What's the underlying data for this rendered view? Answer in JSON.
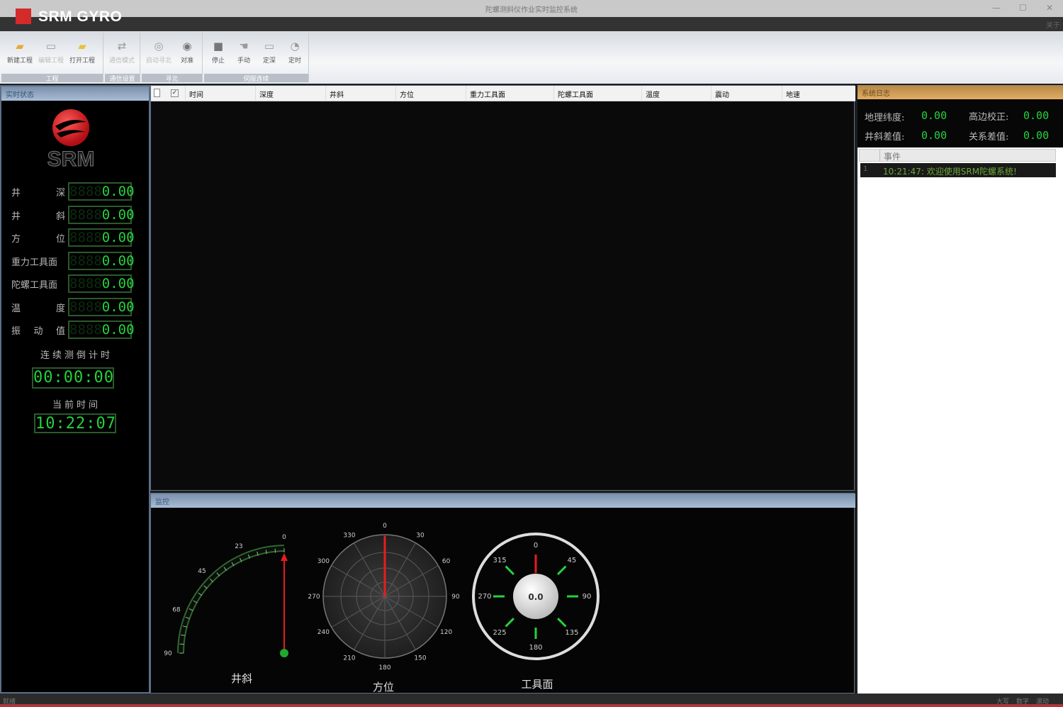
{
  "app": {
    "window_title": "陀螺测斜仪作业实时监控系统",
    "brand": "SRM GYRO",
    "menu_right": "关于"
  },
  "ribbon": {
    "groups": [
      {
        "label": "工程",
        "buttons": [
          "新建工程",
          "编辑工程",
          "打开工程"
        ]
      },
      {
        "label": "通信设置",
        "buttons": [
          "通信模式"
        ]
      },
      {
        "label": "寻北",
        "buttons": [
          "启动寻北",
          "对准"
        ]
      },
      {
        "label": "伺服连续",
        "buttons": [
          "停止",
          "手动",
          "定深",
          "定时"
        ]
      }
    ]
  },
  "realtime": {
    "header": "实时状态",
    "logo_text": "SRM",
    "rows": [
      {
        "label": [
          "井",
          "深"
        ],
        "value": "0.00",
        "ghost": "8888"
      },
      {
        "label": [
          "井",
          "斜"
        ],
        "value": "0.00",
        "ghost": "8888"
      },
      {
        "label": [
          "方",
          "位"
        ],
        "value": "0.00",
        "ghost": "8888"
      },
      {
        "label": [
          "重力工具面"
        ],
        "value": "0.00",
        "ghost": "8888"
      },
      {
        "label": [
          "陀螺工具面"
        ],
        "value": "0.00",
        "ghost": "8888"
      },
      {
        "label": [
          "温",
          "度"
        ],
        "value": "0.00",
        "ghost": "8888"
      },
      {
        "label": [
          "振",
          "动",
          "值"
        ],
        "value": "0.00",
        "ghost": "8888"
      }
    ],
    "countdown_label": "连续测倒计时",
    "countdown_value": "00:00:00",
    "current_time_label": "当前时间",
    "current_time_value": "10:22:07"
  },
  "grid": {
    "columns": [
      "时间",
      "深度",
      "井斜",
      "方位",
      "重力工具面",
      "陀螺工具面",
      "温度",
      "震动",
      "地速"
    ]
  },
  "monitor": {
    "header": "监控",
    "gauge_inclination": {
      "label": "井斜",
      "ticks": [
        "0",
        "23",
        "45",
        "68",
        "90"
      ],
      "value": 0
    },
    "gauge_azimuth": {
      "label": "方位",
      "ticks": [
        "0",
        "30",
        "60",
        "90",
        "120",
        "150",
        "180",
        "210",
        "240",
        "270",
        "300",
        "330"
      ],
      "value": 0
    },
    "gauge_toolface": {
      "label": "工具面",
      "ticks": [
        "0",
        "45",
        "90",
        "135",
        "180",
        "225",
        "270",
        "315"
      ],
      "center_value": "0.0"
    }
  },
  "syslog": {
    "header": "系统日志",
    "geo_lat_label": "地理纬度:",
    "geo_lat_value": "0.00",
    "height_label": "高边校正:",
    "height_value": "0.00",
    "incl_diff_label": "井斜差值:",
    "incl_diff_value": "0.00",
    "rel_diff_label": "关系差值:",
    "rel_diff_value": "0.00",
    "event_col": "事件",
    "events": [
      {
        "index": "1",
        "text": "10:21:47: 欢迎使用SRM陀螺系统!"
      }
    ]
  },
  "statusbar": {
    "left": "就绪",
    "right": [
      "大写",
      "数字",
      "滚动"
    ]
  },
  "colors": {
    "lcd_green": "#25d13d",
    "brand_red": "#d42a2a",
    "needle_red": "#e81c1c"
  }
}
